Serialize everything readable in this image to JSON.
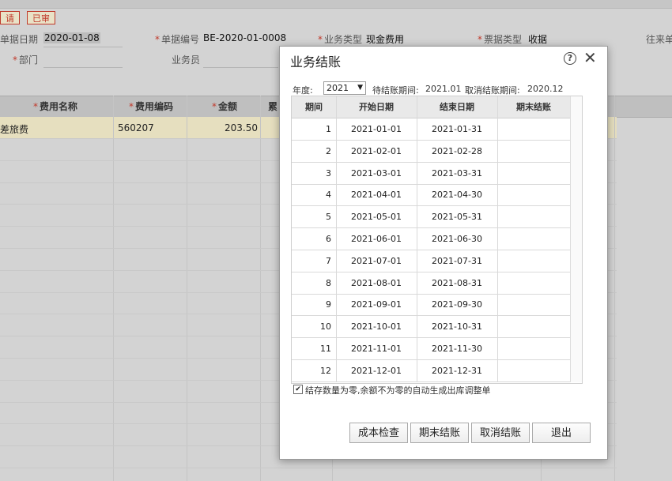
{
  "header": {
    "tag_left": "请",
    "tag_audited": "已审",
    "doc_date_label": "单据日期",
    "doc_date_value": "2020-01-08",
    "doc_no_label": "单据编号",
    "doc_no_value": "BE-2020-01-0008",
    "biz_type_label": "业务类型",
    "biz_type_value": "现金费用",
    "bill_type_label": "票据类型",
    "bill_type_value": "收据",
    "contact_label": "往来单",
    "dept_label": "部门",
    "salesman_label": "业务员"
  },
  "grid": {
    "col_fee_name": "费用名称",
    "col_fee_code": "费用编码",
    "col_amount": "金额",
    "col_extra": "累",
    "row1": {
      "fee_name": "差旅费",
      "fee_code": "560207",
      "amount": "203.50"
    }
  },
  "dialog": {
    "title": "业务结账",
    "year_label": "年度:",
    "year_value": "2021",
    "pending_label": "待结账期间:",
    "pending_value": "2021.01",
    "cancel_label": "取消结账期间:",
    "cancel_value": "2020.12",
    "columns": [
      "期间",
      "开始日期",
      "结束日期",
      "期末结账"
    ],
    "rows": [
      {
        "period": "1",
        "start": "2021-01-01",
        "end": "2021-01-31",
        "closed": ""
      },
      {
        "period": "2",
        "start": "2021-02-01",
        "end": "2021-02-28",
        "closed": ""
      },
      {
        "period": "3",
        "start": "2021-03-01",
        "end": "2021-03-31",
        "closed": ""
      },
      {
        "period": "4",
        "start": "2021-04-01",
        "end": "2021-04-30",
        "closed": ""
      },
      {
        "period": "5",
        "start": "2021-05-01",
        "end": "2021-05-31",
        "closed": ""
      },
      {
        "period": "6",
        "start": "2021-06-01",
        "end": "2021-06-30",
        "closed": ""
      },
      {
        "period": "7",
        "start": "2021-07-01",
        "end": "2021-07-31",
        "closed": ""
      },
      {
        "period": "8",
        "start": "2021-08-01",
        "end": "2021-08-31",
        "closed": ""
      },
      {
        "period": "9",
        "start": "2021-09-01",
        "end": "2021-09-30",
        "closed": ""
      },
      {
        "period": "10",
        "start": "2021-10-01",
        "end": "2021-10-31",
        "closed": ""
      },
      {
        "period": "11",
        "start": "2021-11-01",
        "end": "2021-11-30",
        "closed": ""
      },
      {
        "period": "12",
        "start": "2021-12-01",
        "end": "2021-12-31",
        "closed": ""
      }
    ],
    "checkbox_label": "结存数量为零,余额不为零的自动生成出库调整单",
    "checkbox_checked": true,
    "btn_cost_check": "成本检查",
    "btn_period_close": "期末结账",
    "btn_cancel_close": "取消结账",
    "btn_exit": "退出"
  }
}
